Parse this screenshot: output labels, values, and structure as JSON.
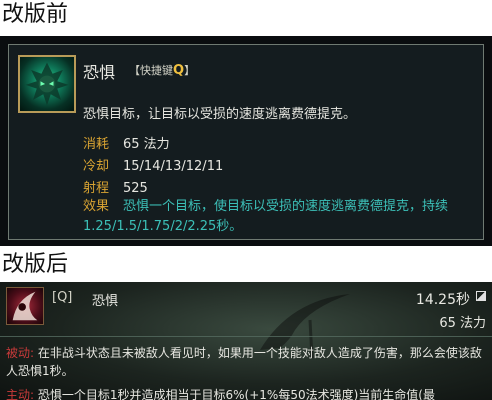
{
  "headings": {
    "before": "改版前",
    "after": "改版后"
  },
  "old_tooltip": {
    "ability_name": "恐惧",
    "hotkey_prefix": "【快捷键",
    "hotkey_key": "Q",
    "hotkey_suffix": "】",
    "description": "恐惧目标，让目标以受损的速度逃离费德提克。",
    "stats": [
      {
        "key": "消耗",
        "value": "65 法力"
      },
      {
        "key": "冷却",
        "value": "15/14/13/12/11"
      },
      {
        "key": "射程",
        "value": "525"
      }
    ],
    "effect_key": "效果",
    "effect_value": "恐惧一个目标，使目标以受损的速度逃离费德提克，持续1.25/1.5/1.75/2/2.25秒。",
    "colors": {
      "label": "#d8a332",
      "effect": "#3cc0b8",
      "hotkey": "#f0c040"
    }
  },
  "new_tooltip": {
    "hotkey": "[Q]",
    "ability_name": "恐惧",
    "cooldown": "14.25秒",
    "cost": "65 法力",
    "passive_tag": "被动:",
    "passive_text": "在非战斗状态且未被敌人看见时，如果用一个技能对敌人造成了伤害，那么会使该敌人恐惧1秒。",
    "active_tag": "主动:",
    "active_text": "恐惧一个目标1秒并造成相当于目标6%(+1%每50法术强度)当前生命值(最",
    "colors": {
      "tag": "#c83a3a"
    }
  }
}
